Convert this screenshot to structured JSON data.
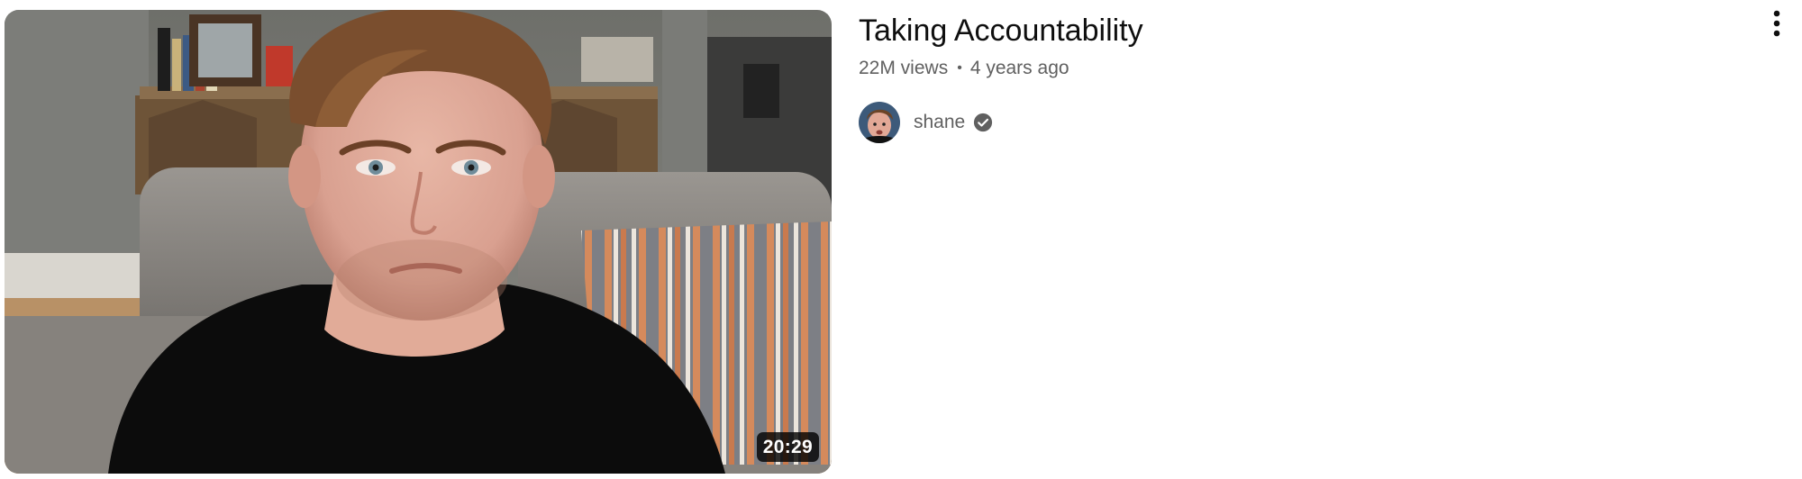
{
  "video": {
    "title": "Taking Accountability",
    "views": "22M views",
    "separator": "•",
    "published": "4 years ago",
    "duration": "20:29",
    "channel": {
      "name": "shane",
      "verified": true,
      "verified_icon": "verified-check-icon",
      "avatar_icon": "channel-avatar"
    },
    "menu_icon": "more-vertical-icon"
  },
  "colors": {
    "title_text": "#0f0f0f",
    "meta_text": "#606060",
    "badge_bg": "#000000cc",
    "badge_text": "#ffffff"
  }
}
